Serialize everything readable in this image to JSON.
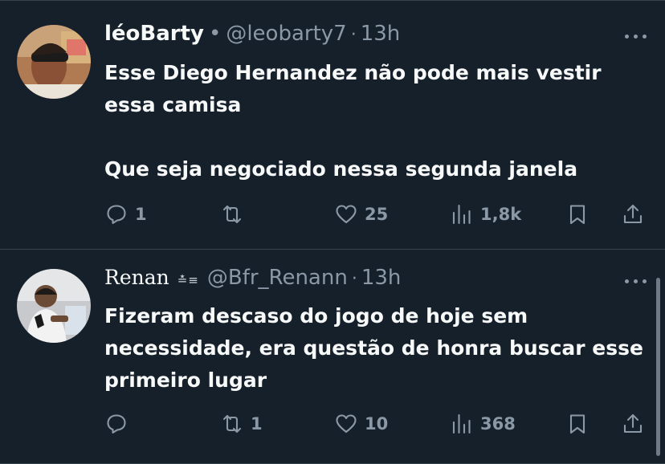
{
  "tweets": [
    {
      "name": "léoBarty",
      "name_suffix": "•",
      "handle": "@leobarty7",
      "time": "13h",
      "body": [
        "Esse Diego Hernandez não pode mais vestir essa camisa",
        "Que seja negociado nessa segunda janela"
      ],
      "replies": "1",
      "retweets": "",
      "likes": "25",
      "views": "1,8k"
    },
    {
      "name": "Renan",
      "name_badge": "≛≡",
      "handle": "@Bfr_Renann",
      "time": "13h",
      "body": [
        "Fizeram descaso do jogo de hoje sem necessidade, era questão de honra buscar esse primeiro lugar"
      ],
      "replies": "",
      "retweets": "1",
      "likes": "10",
      "views": "368"
    }
  ],
  "icons": [
    "reply-icon",
    "retweet-icon",
    "like-icon",
    "views-icon",
    "bookmark-icon",
    "share-icon",
    "more-icon"
  ],
  "colors": {
    "background": "#15202b",
    "text": "#f7f9f9",
    "muted": "#8b98a5",
    "border": "#38444d"
  }
}
